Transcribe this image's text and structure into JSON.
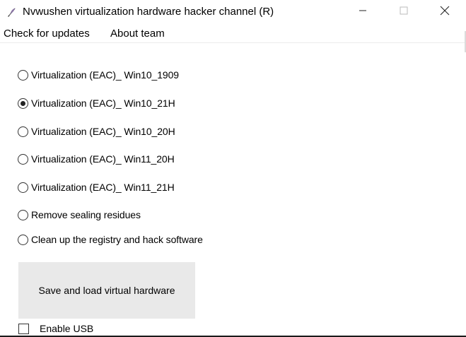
{
  "window": {
    "title": "Nvwushen virtualization hardware hacker channel (R)"
  },
  "menu": {
    "items": [
      {
        "label": "Check for updates"
      },
      {
        "label": "About team"
      }
    ]
  },
  "options": [
    {
      "label": "Virtualization (EAC)_ Win10_1909",
      "checked": false
    },
    {
      "label": "Virtualization (EAC)_ Win10_21H",
      "checked": true
    },
    {
      "label": "Virtualization (EAC)_ Win10_20H",
      "checked": false
    },
    {
      "label": "Virtualization (EAC)_ Win11_20H",
      "checked": false
    },
    {
      "label": "Virtualization (EAC)_ Win11_21H",
      "checked": false
    },
    {
      "label": "Remove sealing residues",
      "checked": false
    },
    {
      "label": "Clean up the registry and hack software",
      "checked": false
    }
  ],
  "action": {
    "label": "Save and load virtual hardware"
  },
  "usb": {
    "label": "Enable USB",
    "checked": false
  },
  "icons": {
    "app": "feather-pen-icon",
    "minimize": "minimize-icon",
    "maximize": "maximize-icon",
    "close": "close-icon"
  }
}
